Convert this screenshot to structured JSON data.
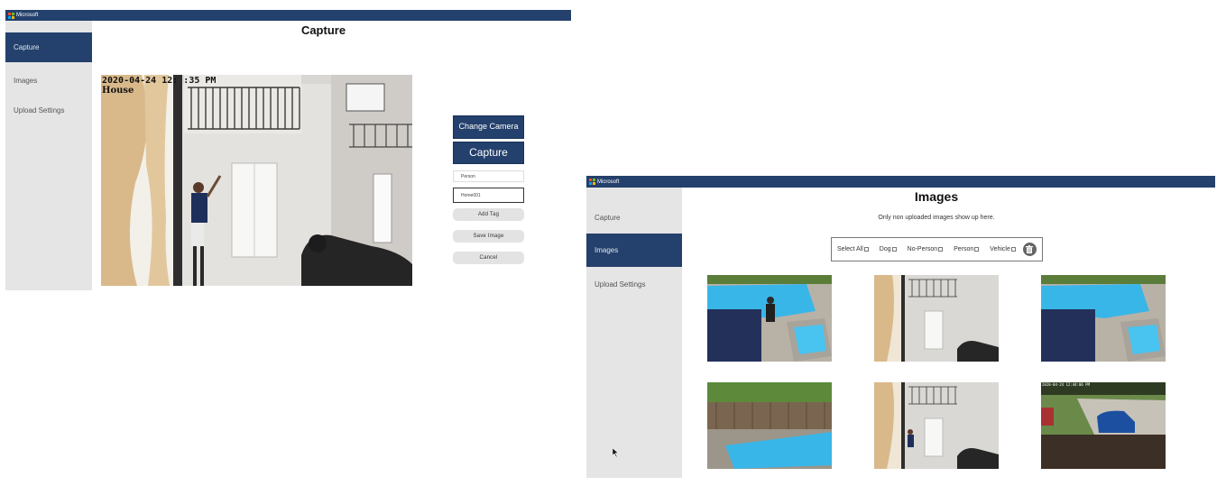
{
  "capture_window": {
    "titlebar": {
      "brand": "Microsoft"
    },
    "sidebar": {
      "items": [
        {
          "label": "Capture"
        },
        {
          "label": "Images"
        },
        {
          "label": "Upload Settings"
        }
      ]
    },
    "page_title": "Capture",
    "camera_overlay": {
      "timestamp": "2020-04-24 12:  :35 PM",
      "location": "House"
    },
    "buttons": {
      "change_camera": "Change Camera",
      "capture": "Capture",
      "add_tag": "Add Tag",
      "save_image": "Save Image",
      "cancel": "Cancel"
    },
    "inputs": {
      "tag_value": "Person",
      "name_value": "Home001"
    }
  },
  "images_window": {
    "titlebar": {
      "brand": "Microsoft"
    },
    "sidebar": {
      "items": [
        {
          "label": "Capture"
        },
        {
          "label": "Images"
        },
        {
          "label": "Upload Settings"
        }
      ]
    },
    "page_title": "Images",
    "subtitle": "Only non uploaded images show up here.",
    "filters": [
      {
        "label": "Select All"
      },
      {
        "label": "Dog"
      },
      {
        "label": "No-Person"
      },
      {
        "label": "Person"
      },
      {
        "label": "Vehicle"
      }
    ],
    "thumbnail_timestamp": "2020-04-24 12:44:06 PM"
  },
  "colors": {
    "accent": "#24406c",
    "sidebar_bg": "#e5e5e5",
    "pool": "#39b6e8"
  }
}
